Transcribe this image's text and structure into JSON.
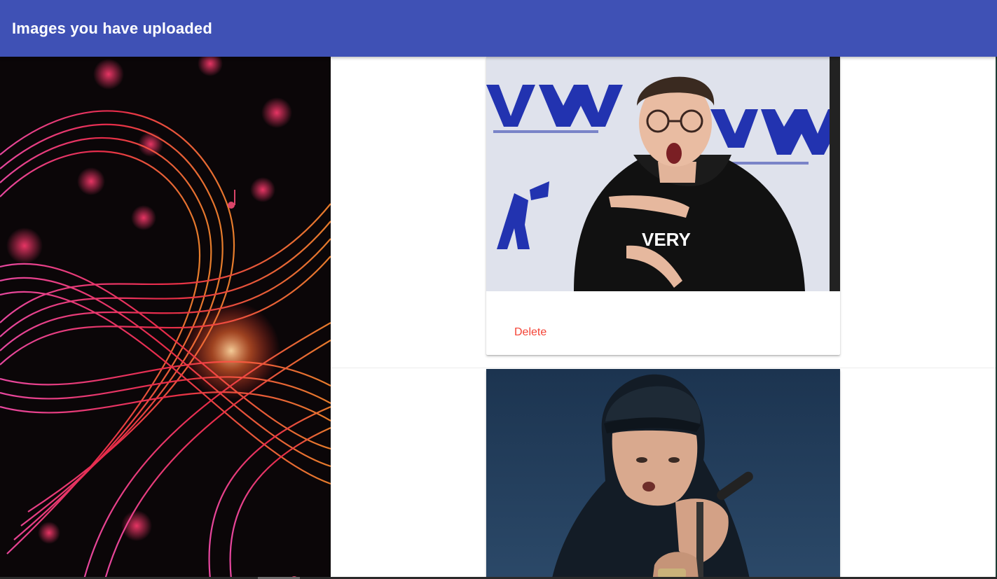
{
  "header": {
    "title": "Images you have uploaded"
  },
  "cards": [
    {
      "image_icon": "photo-person-glasses-icon",
      "delete_label": "Delete"
    },
    {
      "image_icon": "photo-performer-microphone-icon"
    }
  ],
  "colors": {
    "appbar": "#3f51b5",
    "delete": "#f44336",
    "background_panel": "#0b0608"
  }
}
